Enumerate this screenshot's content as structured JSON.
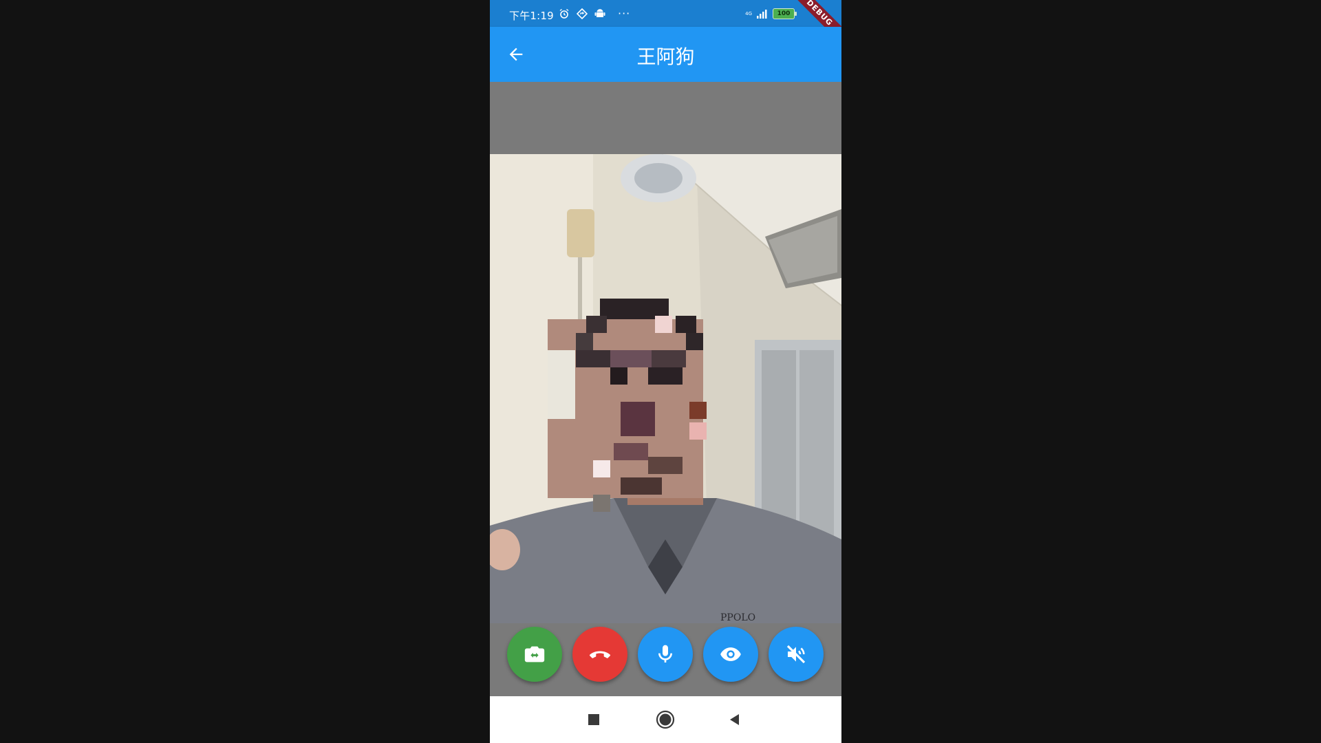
{
  "status_bar": {
    "time": "下午1:19",
    "network_label": "4G",
    "battery_level": "100",
    "debug_badge": "DEBUG"
  },
  "app_bar": {
    "title": "王阿狗",
    "back_icon": "arrow-left-icon"
  },
  "video": {
    "shirt_text": "PPOLO"
  },
  "controls": [
    {
      "name": "switch-camera-button",
      "icon": "switch-camera-icon",
      "color": "#43a047"
    },
    {
      "name": "hang-up-button",
      "icon": "call-end-icon",
      "color": "#e53935"
    },
    {
      "name": "microphone-button",
      "icon": "mic-icon",
      "color": "#2196f3"
    },
    {
      "name": "view-button",
      "icon": "eye-icon",
      "color": "#2196f3"
    },
    {
      "name": "mute-speaker-button",
      "icon": "volume-off-icon",
      "color": "#2196f3"
    }
  ],
  "nav_bar": {
    "items": [
      "recents-icon",
      "home-icon",
      "back-icon"
    ]
  },
  "colors": {
    "app_bar": "#2196f3",
    "status_bar": "#1b7fd0",
    "background": "#121212",
    "panel": "#7a7a7a"
  }
}
